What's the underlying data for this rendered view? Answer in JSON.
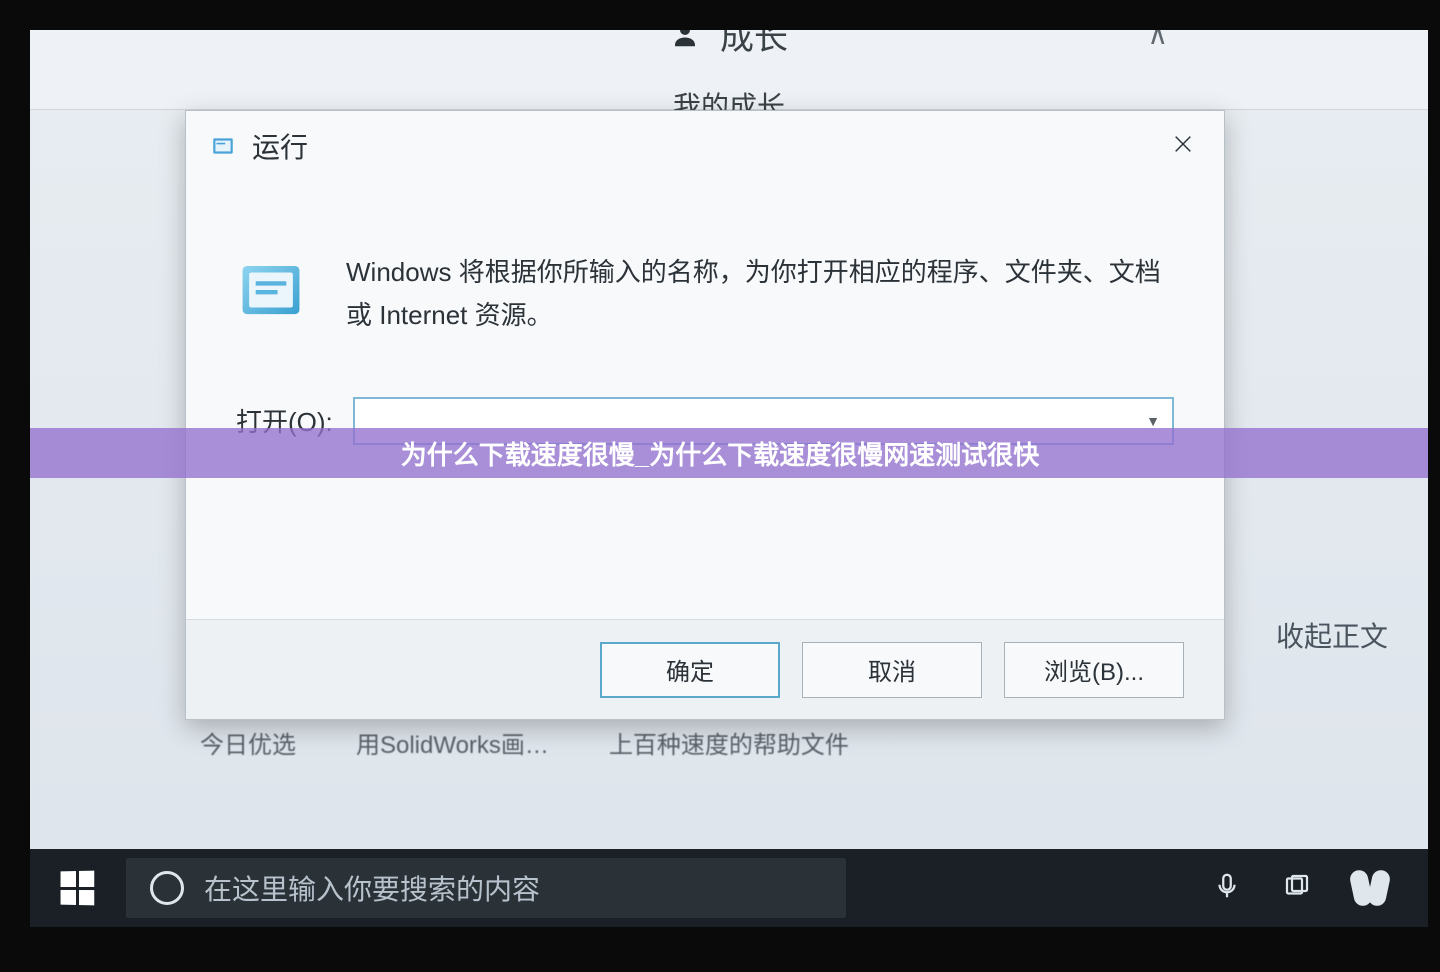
{
  "background_app": {
    "tab_label": "成长",
    "subtitle": "我的成长",
    "collapse_label_char": "∧"
  },
  "run_dialog": {
    "title": "运行",
    "message": "Windows 将根据你所输入的名称，为你打开相应的程序、文件夹、文档或 Internet 资源。",
    "open_label": "打开(O):",
    "input_value": "",
    "buttons": {
      "ok": "确定",
      "cancel": "取消",
      "browse": "浏览(B)..."
    }
  },
  "overlay_banner": {
    "text": "为什么下载速度很慢_为什么下载速度很慢网速测试很快"
  },
  "side_text": "收起正文",
  "obscured_row": {
    "item1": "今日优选",
    "item2": "用SolidWorks画…",
    "item3": "上百种速度的帮助文件"
  },
  "taskbar": {
    "search_placeholder": "在这里输入你要搜索的内容"
  },
  "colors": {
    "dialog_bg": "#f7f9fb",
    "dialog_border_focus": "#5aa8cc",
    "banner_bg": "rgba(147,112,206,0.78)",
    "taskbar_bg": "#1a2026"
  }
}
